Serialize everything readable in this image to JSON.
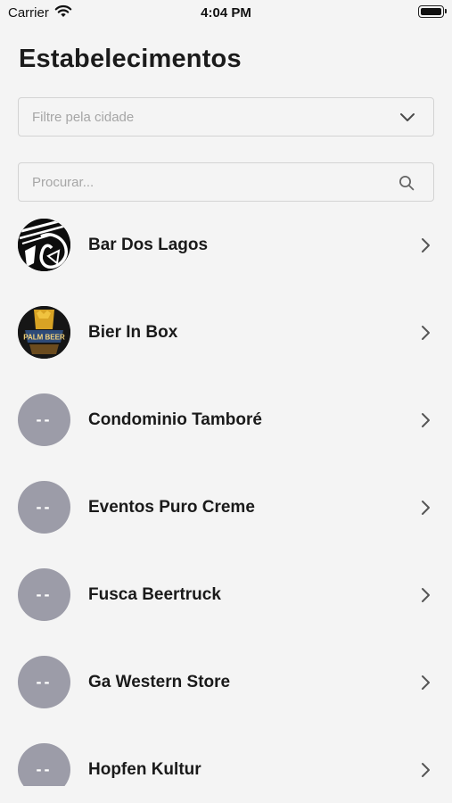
{
  "status_bar": {
    "carrier": "Carrier",
    "time": "4:04 PM"
  },
  "page": {
    "title": "Estabelecimentos"
  },
  "city_filter": {
    "placeholder": "Filtre pela cidade",
    "icon": "chevron-down-icon"
  },
  "search": {
    "placeholder": "Procurar...",
    "icon": "search-icon"
  },
  "establishments": [
    {
      "name": "Bar Dos Lagos",
      "avatar": "bar-dos-lagos-logo",
      "avatar_text": ""
    },
    {
      "name": "Bier In Box",
      "avatar": "palm-beer-logo",
      "avatar_text": "PALM BEER"
    },
    {
      "name": "Condominio Tamboré",
      "avatar": "placeholder",
      "avatar_text": "--"
    },
    {
      "name": "Eventos Puro Creme",
      "avatar": "placeholder",
      "avatar_text": "--"
    },
    {
      "name": "Fusca Beertruck",
      "avatar": "placeholder",
      "avatar_text": "--"
    },
    {
      "name": "Ga Western Store",
      "avatar": "placeholder",
      "avatar_text": "--"
    },
    {
      "name": "Hopfen Kultur",
      "avatar": "placeholder",
      "avatar_text": "--"
    }
  ],
  "colors": {
    "background": "#f4f4f4",
    "placeholder_avatar": "#9c9ca8",
    "border": "#d3d3d3",
    "placeholder_text": "#a6a6a6"
  }
}
